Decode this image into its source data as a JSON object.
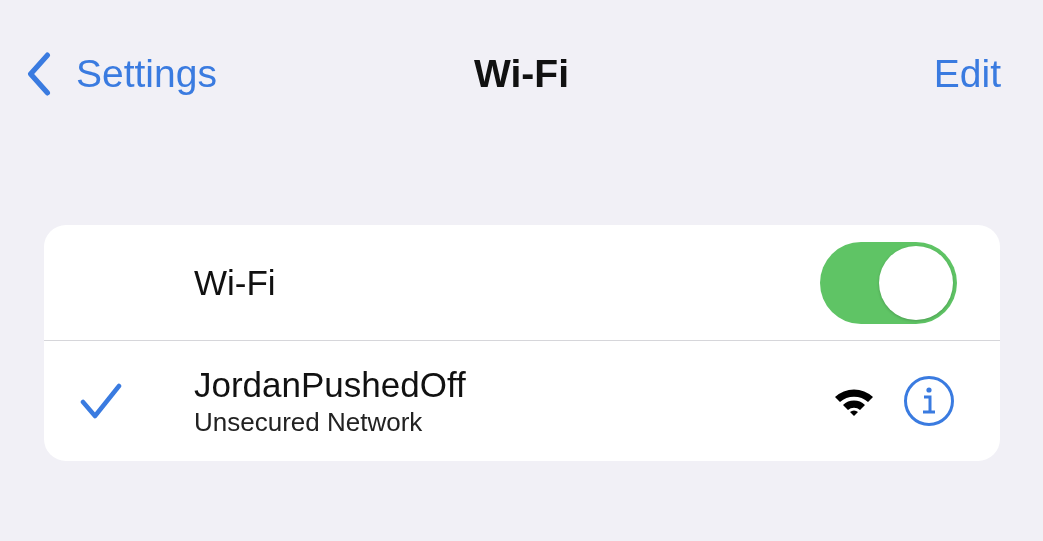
{
  "nav": {
    "back_label": "Settings",
    "title": "Wi-Fi",
    "action": "Edit"
  },
  "wifi": {
    "label": "Wi-Fi",
    "on": true
  },
  "networks": [
    {
      "name": "JordanPushedOff",
      "subtitle": "Unsecured Network",
      "selected": true
    }
  ]
}
